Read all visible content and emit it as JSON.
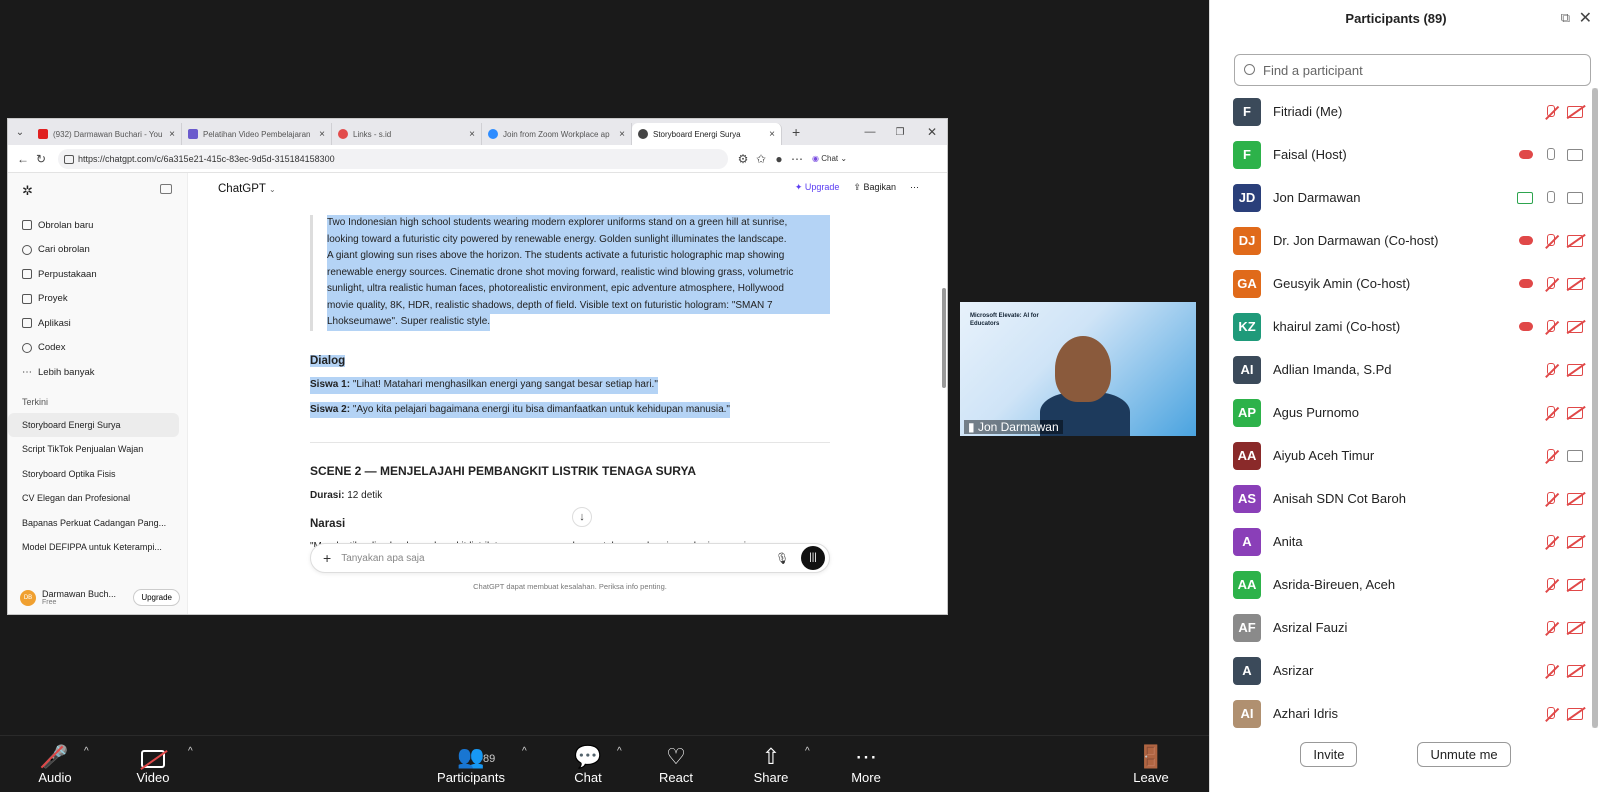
{
  "browser": {
    "tabs": [
      {
        "label": "(932) Darmawan Buchari - You",
        "color": "#e02020"
      },
      {
        "label": "Pelatihan Video Pembelajaran",
        "color": "#6a5acd"
      },
      {
        "label": "Links - s.id",
        "color": "#e24b4b"
      },
      {
        "label": "Join from Zoom Workplace ap",
        "color": "#2d8cff"
      },
      {
        "label": "Storyboard Energi Surya",
        "color": "#444"
      }
    ],
    "url": "https://chatgpt.com/c/6a315e21-415c-83ec-9d5d-315184158300",
    "chat_toggle": "Chat"
  },
  "chatgpt": {
    "title": "ChatGPT",
    "upgrade": "Upgrade",
    "share": "Bagikan",
    "sidebar": {
      "items": [
        "Obrolan baru",
        "Cari obrolan",
        "Perpustakaan",
        "Proyek",
        "Aplikasi",
        "Codex",
        "Lebih banyak"
      ],
      "recent_header": "Terkini",
      "recent": [
        "Storyboard Energi Surya",
        "Script TikTok Penjualan Wajan",
        "Storyboard Optika Fisis",
        "CV Elegan dan Profesional",
        "Bapanas Perkuat Cadangan Pang...",
        "Model DEFIPPA untuk Keterampi..."
      ],
      "user_name": "Darmawan Buch...",
      "user_plan": "Free",
      "user_initials": "DB",
      "upgrade_btn": "Upgrade"
    },
    "content": {
      "prompt_lines": [
        "Two Indonesian high school students wearing modern explorer uniforms stand on a green hill at sunrise,",
        "looking toward a futuristic city powered by renewable energy. Golden sunlight illuminates the landscape.",
        "A giant glowing sun rises above the horizon. The students activate a futuristic holographic map showing",
        "renewable energy sources. Cinematic drone shot moving forward, realistic wind blowing grass, volumetric",
        "sunlight, ultra realistic human faces, photorealistic environment, epic adventure atmosphere, Hollywood",
        "movie quality, 8K, HDR, realistic shadows, depth of field. Visible text on futuristic hologram: \"SMAN 7",
        "Lhokseumawe\". Super realistic style."
      ],
      "dialog_header": "Dialog",
      "siswa1_label": "Siswa 1:",
      "siswa1_text": "\"Lihat! Matahari menghasilkan energi yang sangat besar setiap hari.\"",
      "siswa2_label": "Siswa 2:",
      "siswa2_text": "\"Ayo kita pelajari bagaimana energi itu bisa dimanfaatkan untuk kehidupan manusia.\"",
      "scene2_title": "SCENE 2 — MENJELAJAHI PEMBANGKIT LISTRIK TENAGA SURYA",
      "durasi_label": "Durasi:",
      "durasi_value": "12 detik",
      "narasi_header": "Narasi",
      "narasi_partial": "\"Mereka tiba di sebuah pembangkit listrik tenaga surya modern untuk memahami cara kerja energi"
    },
    "composer_placeholder": "Tanyakan apa saja",
    "disclaimer": "ChatGPT dapat membuat kesalahan. Periksa info penting."
  },
  "video": {
    "name": "Jon Darmawan",
    "brand": "Microsoft Elevate: AI for Educators"
  },
  "participants": {
    "title": "Participants (89)",
    "search_placeholder": "Find a participant",
    "list": [
      {
        "initials": "F",
        "name": "Fitriadi (Me)",
        "color": "#3b4a5a",
        "mic": "off",
        "cam": "off"
      },
      {
        "initials": "F",
        "name": "Faisal (Host)",
        "color": "#2db24a",
        "mic": "on",
        "cam": "on",
        "cloud": true
      },
      {
        "initials": "JD",
        "name": "Jon Darmawan",
        "color": "#2a3f7a",
        "mic": "on",
        "cam": "on",
        "share": true
      },
      {
        "initials": "DJ",
        "name": "Dr. Jon Darmawan (Co-host)",
        "color": "#e06a1a",
        "mic": "off",
        "cam": "off",
        "cloud": true
      },
      {
        "initials": "GA",
        "name": "Geusyik Amin (Co-host)",
        "color": "#e06a1a",
        "mic": "off",
        "cam": "off",
        "cloud": true
      },
      {
        "initials": "KZ",
        "name": "khairul zami (Co-host)",
        "color": "#1f9a7a",
        "mic": "off",
        "cam": "off",
        "cloud": true
      },
      {
        "initials": "AI",
        "name": "Adlian Imanda, S.Pd",
        "color": "#3b4a5a",
        "mic": "off",
        "cam": "off"
      },
      {
        "initials": "AP",
        "name": "Agus Purnomo",
        "color": "#2db24a",
        "mic": "off",
        "cam": "off"
      },
      {
        "initials": "AA",
        "name": "Aiyub Aceh Timur",
        "color": "#8a2a2a",
        "mic": "off",
        "cam": "on"
      },
      {
        "initials": "AS",
        "name": "Anisah SDN Cot Baroh",
        "color": "#8a3fb8",
        "mic": "off",
        "cam": "off"
      },
      {
        "initials": "A",
        "name": "Anita",
        "color": "#8a3fb8",
        "mic": "off",
        "cam": "off"
      },
      {
        "initials": "AA",
        "name": "Asrida-Bireuen, Aceh",
        "color": "#2db24a",
        "mic": "off",
        "cam": "off"
      },
      {
        "initials": "AF",
        "name": "Asrizal Fauzi",
        "color": "#8a8a8a",
        "mic": "off",
        "cam": "off"
      },
      {
        "initials": "A",
        "name": "Asrizar",
        "color": "#3b4a5a",
        "mic": "off",
        "cam": "off"
      },
      {
        "initials": "AI",
        "name": "Azhari Idris",
        "color": "#b09070",
        "mic": "off",
        "cam": "off"
      }
    ],
    "invite": "Invite",
    "unmute": "Unmute me"
  },
  "toolbar": {
    "audio": "Audio",
    "video": "Video",
    "participants": "Participants",
    "participants_count": "89",
    "chat": "Chat",
    "react": "React",
    "share": "Share",
    "more": "More",
    "leave": "Leave"
  }
}
